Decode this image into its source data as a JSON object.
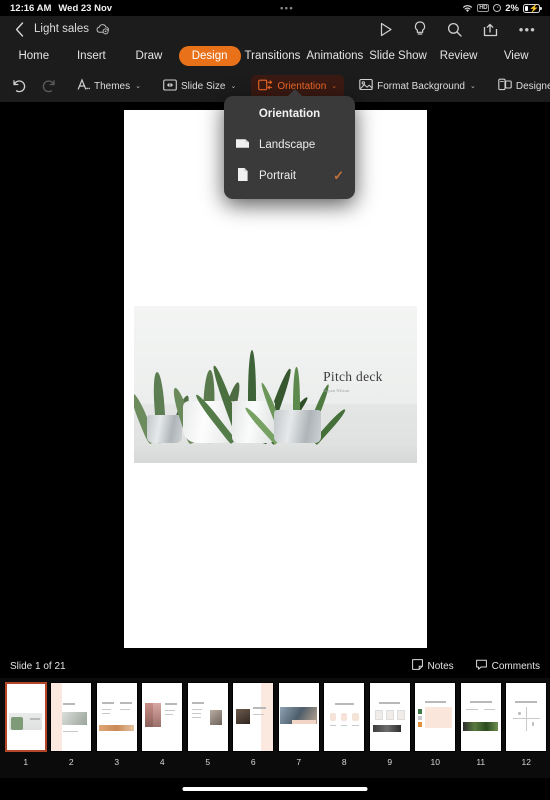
{
  "status_bar": {
    "time": "12:16 AM",
    "date": "Wed 23 Nov",
    "center_dots": "•••",
    "battery_percent": "2%",
    "icons": [
      "wifi-icon",
      "hd-badge-icon",
      "orientation-lock-icon",
      "battery-charging-icon"
    ]
  },
  "app_header": {
    "back_label": "‹",
    "document_title": "Light sales",
    "cloud_status_icon": "cloud-sync-icon",
    "actions": [
      {
        "name": "present-button",
        "icon": "play-icon"
      },
      {
        "name": "tell-me-button",
        "icon": "lightbulb-icon"
      },
      {
        "name": "search-button",
        "icon": "search-icon"
      },
      {
        "name": "share-button",
        "icon": "share-icon"
      },
      {
        "name": "more-button",
        "icon": "ellipsis-icon",
        "glyph": "•••"
      }
    ]
  },
  "ribbon_tabs": [
    {
      "label": "Home",
      "active": false
    },
    {
      "label": "Insert",
      "active": false
    },
    {
      "label": "Draw",
      "active": false
    },
    {
      "label": "Design",
      "active": true
    },
    {
      "label": "Transitions",
      "active": false
    },
    {
      "label": "Animations",
      "active": false
    },
    {
      "label": "Slide Show",
      "active": false
    },
    {
      "label": "Review",
      "active": false
    },
    {
      "label": "View",
      "active": false
    }
  ],
  "toolbar": {
    "undo_label": "undo-icon",
    "redo_label": "redo-icon",
    "themes_label": "Themes",
    "slide_size_label": "Slide Size",
    "orientation_label": "Orientation",
    "format_background_label": "Format Background",
    "designer_label": "Designer",
    "chevron": "⌄",
    "active_accent": "#f06a28",
    "active_bg": "#3a1a12"
  },
  "orientation_menu": {
    "title": "Orientation",
    "items": [
      {
        "label": "Landscape",
        "icon": "document-landscape-icon",
        "checked": false,
        "check_glyph": ""
      },
      {
        "label": "Portrait",
        "icon": "document-portrait-icon",
        "checked": true,
        "check_glyph": "✓"
      }
    ],
    "check_color": "#c0703a"
  },
  "slide": {
    "title": "Pitch deck",
    "subtitle": "Bryan Nilson",
    "photo_alt": "potted-succulents-photo"
  },
  "bottom_status": {
    "slide_counter": "Slide 1 of 21",
    "notes_label": "Notes",
    "comments_label": "Comments"
  },
  "thumbnails": [
    {
      "num": "1",
      "selected": true,
      "kind": "cover"
    },
    {
      "num": "2",
      "selected": false,
      "kind": "photo-wide"
    },
    {
      "num": "3",
      "selected": false,
      "kind": "band-orange"
    },
    {
      "num": "4",
      "selected": false,
      "kind": "two-people"
    },
    {
      "num": "5",
      "selected": false,
      "kind": "small-photo"
    },
    {
      "num": "6",
      "selected": false,
      "kind": "dark-photo"
    },
    {
      "num": "7",
      "selected": false,
      "kind": "wide-team"
    },
    {
      "num": "8",
      "selected": false,
      "kind": "process"
    },
    {
      "num": "9",
      "selected": false,
      "kind": "market-forecast"
    },
    {
      "num": "10",
      "selected": false,
      "kind": "market-competitors"
    },
    {
      "num": "11",
      "selected": false,
      "kind": "our-competitors"
    },
    {
      "num": "12",
      "selected": false,
      "kind": "competitive-chart"
    }
  ]
}
